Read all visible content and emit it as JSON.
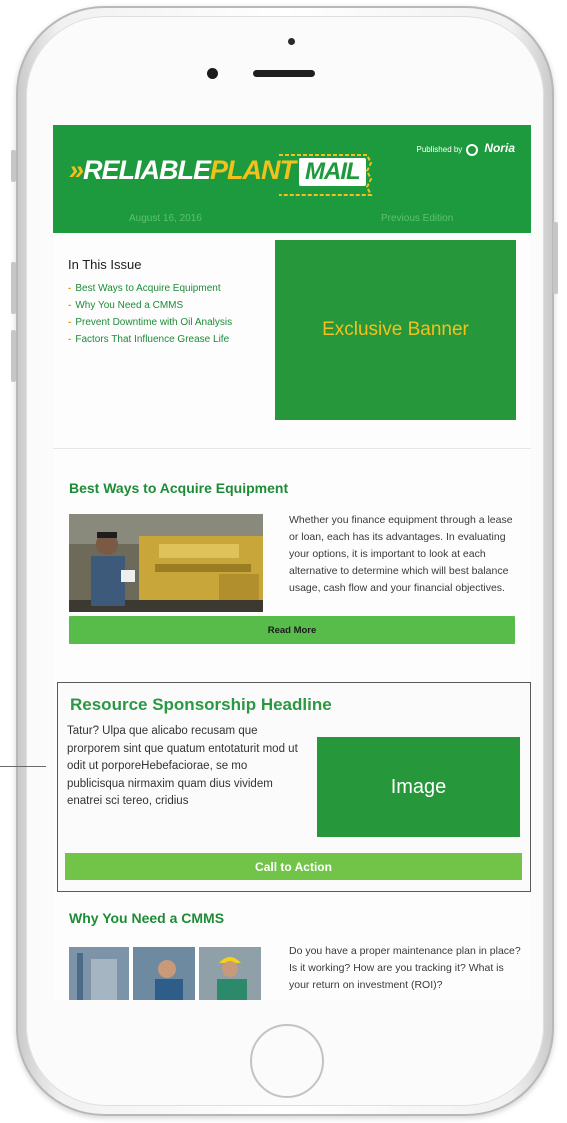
{
  "newsletter": {
    "logo_prefix": "»",
    "logo_reliable": "RELIABLE",
    "logo_plant": "PLANT",
    "logo_mail": "MAIL",
    "published_by": "Published by",
    "publisher": "Noria",
    "date": "August 16, 2016",
    "previous_edition": "Previous Edition"
  },
  "in_this_issue": {
    "title": "In This Issue",
    "items": [
      {
        "label": "Best Ways to Acquire Equipment"
      },
      {
        "label": "Why You Need a CMMS"
      },
      {
        "label": "Prevent Downtime with Oil Analysis"
      },
      {
        "label": "Factors That Influence Grease Life"
      }
    ]
  },
  "banner": {
    "label": "Exclusive Banner"
  },
  "article1": {
    "heading": "Best Ways to Acquire Equipment",
    "body": "Whether you finance equipment through a lease or loan, each has its advantages. In evaluating your options, it is important to look at each alternative to determine which will best balance usage, cash flow and your financial objectives.",
    "button": "Read More"
  },
  "sponsor": {
    "heading": "Resource Sponsorship Headline",
    "body": "Tatur? Ulpa que alicabo recusam que prorporem sint que quatum entotaturit mod ut odit ut porporeHebefaciorae, se mo publicisqua nirmaxim quam dius vividem enatrei sci tereo, cridius",
    "image_label": "Image",
    "cta": "Call to Action"
  },
  "article2": {
    "heading": "Why You Need a CMMS",
    "body": "Do you have a proper maintenance plan in place? Is it working? How are you tracking it? What is your return on investment (ROI)?"
  },
  "colors": {
    "masthead_green": "#1e9a3e",
    "accent_yellow": "#f2c11b",
    "link_green": "#1e8c36",
    "button_green": "#57bc4a",
    "cta_green": "#72c449",
    "bullet_orange": "#f29b1b"
  }
}
